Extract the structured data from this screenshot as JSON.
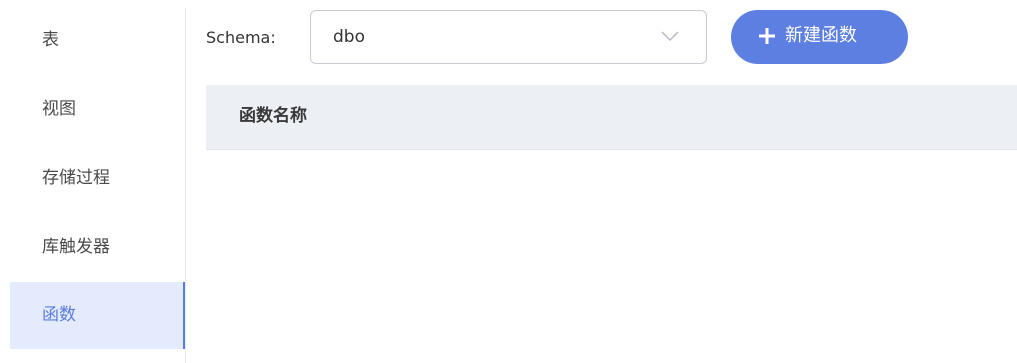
{
  "sidebar": {
    "items": [
      {
        "label": "表",
        "active": false
      },
      {
        "label": "视图",
        "active": false
      },
      {
        "label": "存储过程",
        "active": false
      },
      {
        "label": "库触发器",
        "active": false
      },
      {
        "label": "函数",
        "active": true
      }
    ]
  },
  "toolbar": {
    "schema_label": "Schema:",
    "schema_value": "dbo",
    "new_button_label": "新建函数",
    "new_button_icon": "plus-icon"
  },
  "table": {
    "columns": [
      "函数名称"
    ],
    "rows": []
  },
  "colors": {
    "accent": "#5c7fe1",
    "active_item_bg": "#e4ebfc",
    "header_bg": "#eceff4"
  }
}
